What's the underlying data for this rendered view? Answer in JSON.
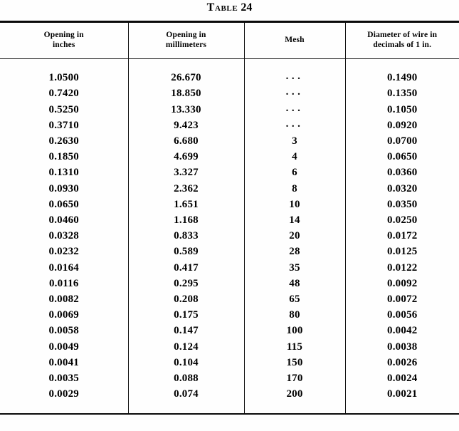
{
  "title": {
    "label": "Table",
    "number": "24"
  },
  "table": {
    "columns": [
      {
        "id": "opening-inches",
        "header_line1": "Opening in",
        "header_line2": "inches"
      },
      {
        "id": "opening-millimeters",
        "header_line1": "Opening in",
        "header_line2": "millimeters"
      },
      {
        "id": "mesh",
        "header_line1": "Mesh",
        "header_line2": ""
      },
      {
        "id": "wire-diameter",
        "header_line1": "Diameter of wire in",
        "header_line2": "decimals of 1 in."
      }
    ],
    "rows": [
      {
        "opening_inches": "1.0500",
        "opening_mm": "26.670",
        "mesh": "...",
        "wire_diameter": "0.1490"
      },
      {
        "opening_inches": "0.7420",
        "opening_mm": "18.850",
        "mesh": "...",
        "wire_diameter": "0.1350"
      },
      {
        "opening_inches": "0.5250",
        "opening_mm": "13.330",
        "mesh": "...",
        "wire_diameter": "0.1050"
      },
      {
        "opening_inches": "0.3710",
        "opening_mm": "9.423",
        "mesh": "...",
        "wire_diameter": "0.0920"
      },
      {
        "opening_inches": "0.2630",
        "opening_mm": "6.680",
        "mesh": "3",
        "wire_diameter": "0.0700"
      },
      {
        "opening_inches": "0.1850",
        "opening_mm": "4.699",
        "mesh": "4",
        "wire_diameter": "0.0650"
      },
      {
        "opening_inches": "0.1310",
        "opening_mm": "3.327",
        "mesh": "6",
        "wire_diameter": "0.0360"
      },
      {
        "opening_inches": "0.0930",
        "opening_mm": "2.362",
        "mesh": "8",
        "wire_diameter": "0.0320"
      },
      {
        "opening_inches": "0.0650",
        "opening_mm": "1.651",
        "mesh": "10",
        "wire_diameter": "0.0350"
      },
      {
        "opening_inches": "0.0460",
        "opening_mm": "1.168",
        "mesh": "14",
        "wire_diameter": "0.0250"
      },
      {
        "opening_inches": "0.0328",
        "opening_mm": "0.833",
        "mesh": "20",
        "wire_diameter": "0.0172"
      },
      {
        "opening_inches": "0.0232",
        "opening_mm": "0.589",
        "mesh": "28",
        "wire_diameter": "0.0125"
      },
      {
        "opening_inches": "0.0164",
        "opening_mm": "0.417",
        "mesh": "35",
        "wire_diameter": "0.0122"
      },
      {
        "opening_inches": "0.0116",
        "opening_mm": "0.295",
        "mesh": "48",
        "wire_diameter": "0.0092"
      },
      {
        "opening_inches": "0.0082",
        "opening_mm": "0.208",
        "mesh": "65",
        "wire_diameter": "0.0072"
      },
      {
        "opening_inches": "0.0069",
        "opening_mm": "0.175",
        "mesh": "80",
        "wire_diameter": "0.0056"
      },
      {
        "opening_inches": "0.0058",
        "opening_mm": "0.147",
        "mesh": "100",
        "wire_diameter": "0.0042"
      },
      {
        "opening_inches": "0.0049",
        "opening_mm": "0.124",
        "mesh": "115",
        "wire_diameter": "0.0038"
      },
      {
        "opening_inches": "0.0041",
        "opening_mm": "0.104",
        "mesh": "150",
        "wire_diameter": "0.0026"
      },
      {
        "opening_inches": "0.0035",
        "opening_mm": "0.088",
        "mesh": "170",
        "wire_diameter": "0.0024"
      },
      {
        "opening_inches": "0.0029",
        "opening_mm": "0.074",
        "mesh": "200",
        "wire_diameter": "0.0021"
      }
    ]
  }
}
